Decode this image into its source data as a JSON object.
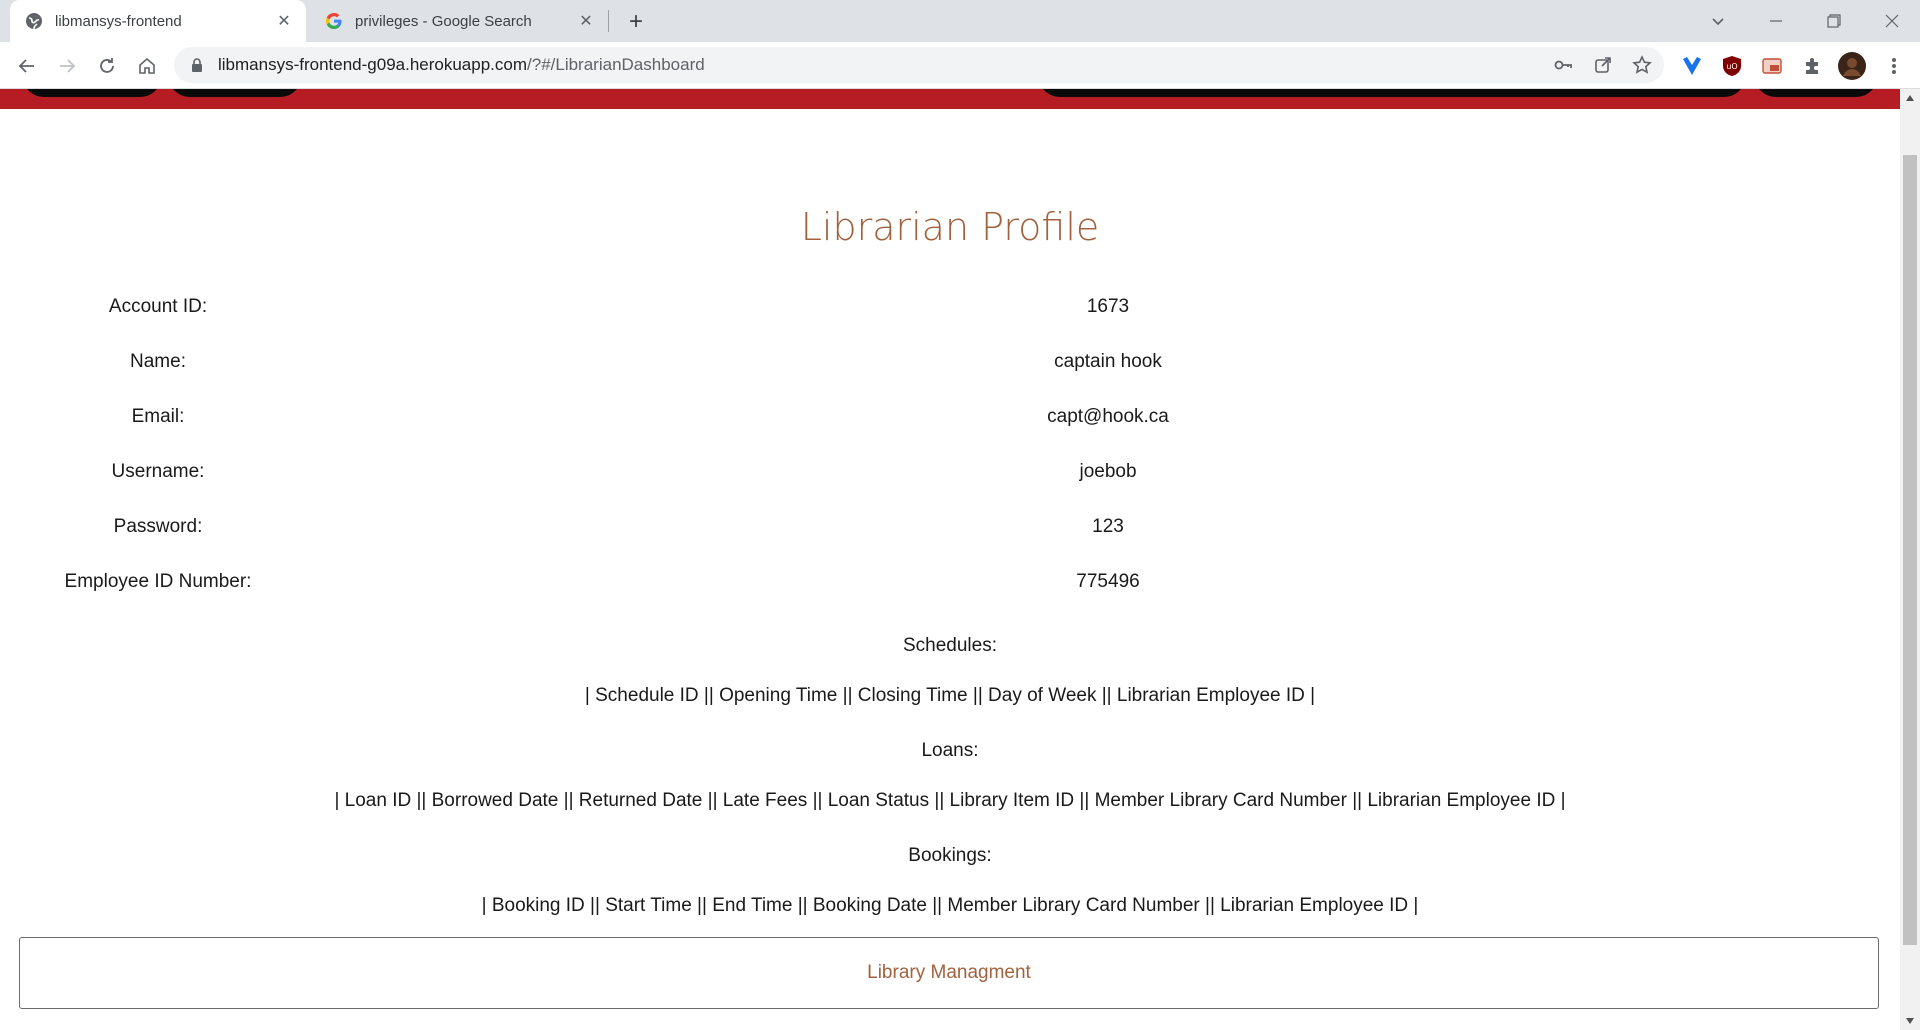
{
  "browser": {
    "tabs": [
      {
        "title": "libmansys-frontend",
        "active": true,
        "icon": "globe-icon"
      },
      {
        "title": "privileges - Google Search",
        "active": false,
        "icon": "google-icon"
      }
    ],
    "url_host": "libmansys-frontend-g09a.herokuapp.com",
    "url_path": "/?#/LibrarianDashboard"
  },
  "profile": {
    "title": "Librarian Profile",
    "fields": [
      {
        "label": "Account ID:",
        "value": "1673"
      },
      {
        "label": "Name:",
        "value": "captain hook"
      },
      {
        "label": "Email:",
        "value": "capt@hook.ca"
      },
      {
        "label": "Username:",
        "value": "joebob"
      },
      {
        "label": "Password:",
        "value": "123"
      },
      {
        "label": "Employee ID Number:",
        "value": "775496"
      }
    ]
  },
  "sections": {
    "schedules_label": "Schedules:",
    "schedules_header": "| Schedule ID || Opening Time || Closing Time || Day of Week || Librarian Employee ID |",
    "loans_label": "Loans:",
    "loans_header": "| Loan ID || Borrowed Date || Returned Date || Late Fees || Loan Status || Library Item ID || Member Library Card Number || Librarian Employee ID |",
    "bookings_label": "Bookings:",
    "bookings_header": "| Booking ID || Start Time || End Time || Booking Date || Member Library Card Number || Librarian Employee ID |"
  },
  "footer": {
    "text": "Library Managment"
  },
  "colors": {
    "navbar": "#b61c23",
    "accent": "#a0623e"
  }
}
